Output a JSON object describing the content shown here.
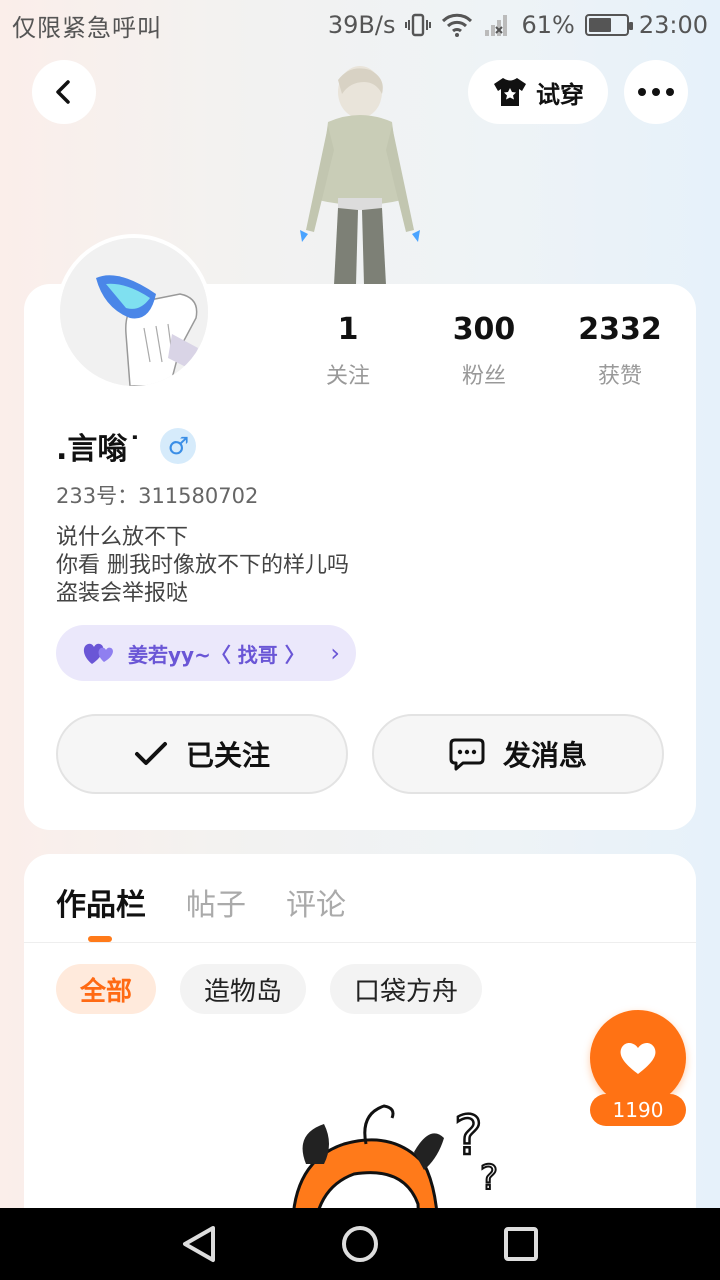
{
  "status_bar": {
    "left_text": "仅限紧急呼叫",
    "net_speed": "39B/s",
    "battery": "61%",
    "battery_level": 0.61,
    "time": "23:00"
  },
  "header": {
    "tryon_label": "试穿"
  },
  "profile": {
    "stats": [
      {
        "num": "1",
        "label": "关注"
      },
      {
        "num": "300",
        "label": "粉丝"
      },
      {
        "num": "2332",
        "label": "获赞"
      }
    ],
    "nickname": ".言嗡˙",
    "gender_symbol": "♂",
    "uid": "233号：311580702",
    "bio": [
      "说什么放不下",
      "你看 删我时像放不下的样儿吗",
      "盗装会举报哒"
    ],
    "cp": {
      "text": "姜若yy~〈 找哥 〉",
      "chevron": "›"
    },
    "follow_button": "已关注",
    "message_button": "发消息"
  },
  "works": {
    "tabs": [
      "作品栏",
      "帖子",
      "评论"
    ],
    "chips": [
      "全部",
      "造物岛",
      "口袋方舟"
    ]
  },
  "fab": {
    "count": "1190"
  },
  "colors": {
    "accent": "#ff7214",
    "cp_purple": "#6a56d6",
    "gender_blue": "#3a8ee6"
  }
}
